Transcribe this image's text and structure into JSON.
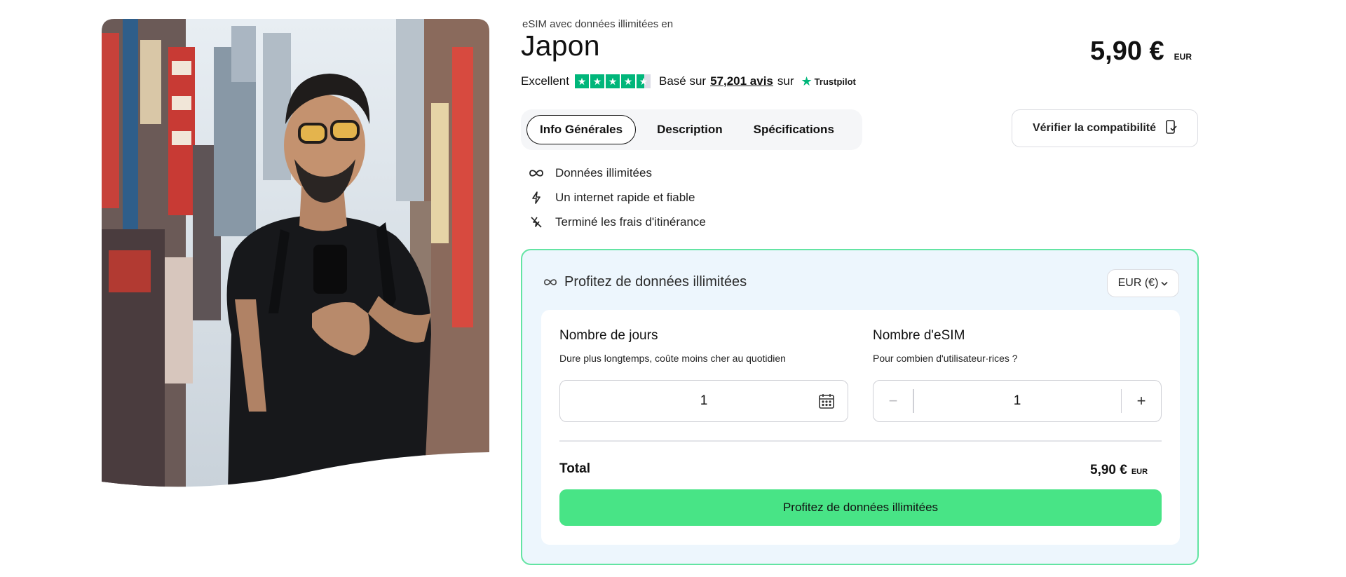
{
  "product": {
    "subtitle": "eSIM avec données illimitées en",
    "title": "Japon"
  },
  "rating": {
    "label": "Excellent",
    "stars": 4.5,
    "based_on": "Basé sur",
    "reviews": "57,201 avis",
    "on": "sur",
    "provider": "Trustpilot"
  },
  "price": {
    "value": "5,90 €",
    "currency": "EUR"
  },
  "tabs": [
    {
      "label": "Info Générales",
      "active": true
    },
    {
      "label": "Description",
      "active": false
    },
    {
      "label": "Spécifications",
      "active": false
    }
  ],
  "compat_button": {
    "label": "Vérifier la compatibilité",
    "icon": "phone-check-icon"
  },
  "features": [
    {
      "icon": "infinity-icon",
      "label": "Données illimitées"
    },
    {
      "icon": "lightning-icon",
      "label": "Un internet rapide et fiable"
    },
    {
      "icon": "no-roaming-icon",
      "label": "Terminé les frais d'itinérance"
    }
  ],
  "plan": {
    "heading": "Profitez de données illimitées",
    "currency_select": "EUR (€)",
    "days": {
      "label": "Nombre de jours",
      "hint": "Dure plus longtemps, coûte moins cher au quotidien",
      "value": "1"
    },
    "esims": {
      "label": "Nombre d'eSIM",
      "hint": "Pour combien d'utilisateur·rices ?",
      "value": "1",
      "minus": "−",
      "plus": "+"
    },
    "total": {
      "label": "Total",
      "value": "5,90 €",
      "currency": "EUR"
    },
    "cta": "Profitez de données illimitées"
  },
  "colors": {
    "accent_green": "#48e486",
    "card_border": "#63e4a3",
    "card_bg": "#edf6fd",
    "trustpilot_green": "#00b67a"
  }
}
